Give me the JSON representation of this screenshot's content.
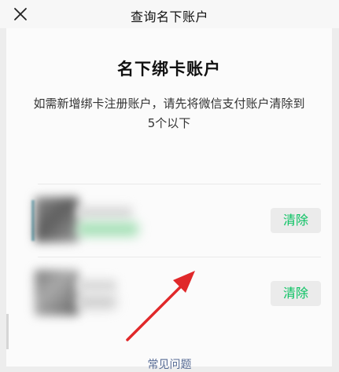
{
  "topbar": {
    "title": "查询名下账户",
    "close_icon": "close-icon"
  },
  "main": {
    "heading": "名下绑卡账户",
    "description": "如需新增绑卡注册账户，请先将微信支付账户清除到5个以下"
  },
  "accounts": [
    {
      "clear_label": "清除"
    },
    {
      "clear_label": "清除"
    }
  ],
  "footer": {
    "faq_label": "常见问题"
  },
  "colors": {
    "accent_green": "#07c160",
    "link_blue": "#576b95",
    "annotation_red": "#e0282a"
  }
}
